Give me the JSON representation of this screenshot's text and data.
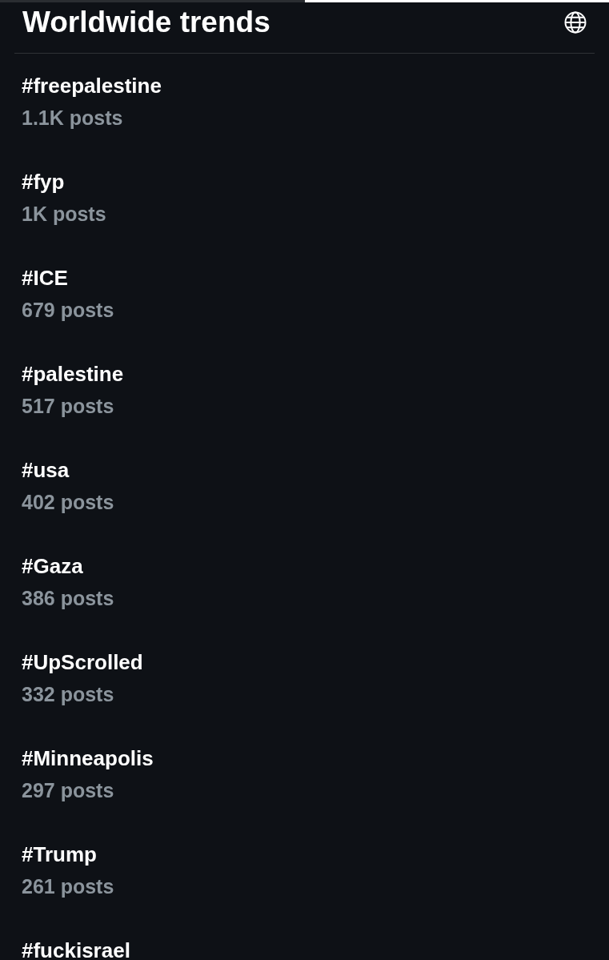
{
  "loading_bar": {
    "level": 0.5
  },
  "header": {
    "title": "Worldwide trends"
  },
  "trends": [
    {
      "tag": "#freepalestine",
      "count": "1.1K posts"
    },
    {
      "tag": "#fyp",
      "count": "1K posts"
    },
    {
      "tag": "#ICE",
      "count": "679 posts"
    },
    {
      "tag": "#palestine",
      "count": "517 posts"
    },
    {
      "tag": "#usa",
      "count": "402 posts"
    },
    {
      "tag": "#Gaza",
      "count": "386 posts"
    },
    {
      "tag": "#UpScrolled",
      "count": "332 posts"
    },
    {
      "tag": "#Minneapolis",
      "count": "297 posts"
    },
    {
      "tag": "#Trump",
      "count": "261 posts"
    },
    {
      "tag": "#fuckisrael"
    }
  ]
}
